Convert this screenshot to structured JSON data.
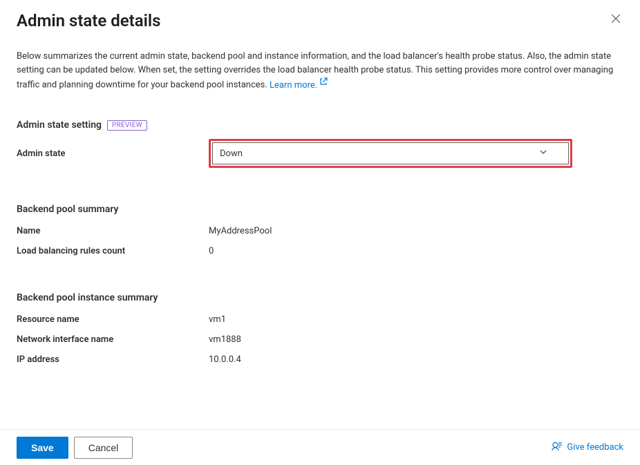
{
  "header": {
    "title": "Admin state details"
  },
  "description": {
    "text": "Below summarizes the current admin state, backend pool and instance information, and the load balancer's health probe status. Also, the admin state setting can be updated below. When set, the setting overrides the load balancer health probe status. This setting provides more control over managing traffic and planning downtime for your backend pool instances.",
    "learn_more": "Learn more."
  },
  "admin_state_section": {
    "heading": "Admin state setting",
    "badge": "PREVIEW",
    "label": "Admin state",
    "selected": "Down"
  },
  "backend_pool_summary": {
    "heading": "Backend pool summary",
    "name_label": "Name",
    "name_value": "MyAddressPool",
    "rules_label": "Load balancing rules count",
    "rules_value": "0"
  },
  "backend_pool_instance": {
    "heading": "Backend pool instance summary",
    "resource_label": "Resource name",
    "resource_value": "vm1",
    "nic_label": "Network interface name",
    "nic_value": "vm1888",
    "ip_label": "IP address",
    "ip_value": "10.0.0.4"
  },
  "footer": {
    "save": "Save",
    "cancel": "Cancel",
    "feedback": "Give feedback"
  }
}
